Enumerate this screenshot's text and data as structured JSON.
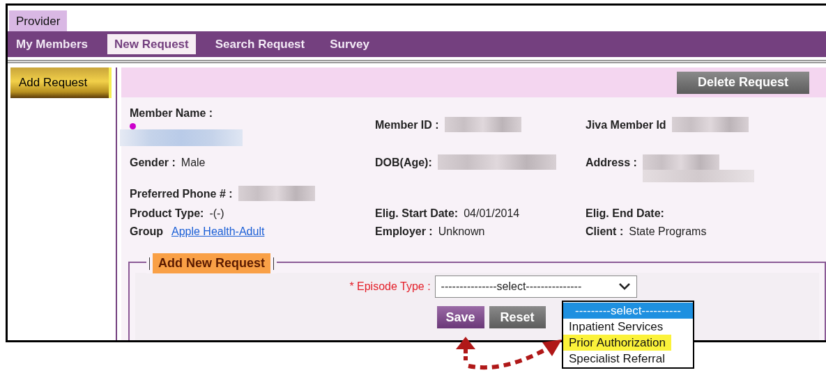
{
  "top_tab": {
    "label": "Provider"
  },
  "nav": [
    {
      "label": "My Members",
      "selected": false
    },
    {
      "label": "New Request",
      "selected": true
    },
    {
      "label": "Search Request",
      "selected": false
    },
    {
      "label": "Survey",
      "selected": false
    }
  ],
  "sidebar": {
    "button": "Add Request"
  },
  "header": {
    "delete_button": "Delete Request"
  },
  "member_fields": [
    [
      {
        "kind": "redacted",
        "label": "Member Name :",
        "flagged": true
      },
      {
        "kind": "redacted",
        "label": "Member ID :"
      },
      {
        "kind": "redacted",
        "label": "Jiva Member Id"
      }
    ],
    [
      {
        "kind": "text",
        "label": "Gender :",
        "value": "Male"
      },
      {
        "kind": "redacted",
        "label": "DOB(Age):"
      },
      {
        "kind": "redacted",
        "label": "Address :"
      }
    ],
    [
      {
        "kind": "redacted",
        "label": "Preferred Phone # :"
      }
    ],
    [
      {
        "kind": "text",
        "label": "Product Type:",
        "value": "-(-)"
      },
      {
        "kind": "text",
        "label": "Elig. Start Date:",
        "value": "04/01/2014"
      },
      {
        "kind": "text",
        "label": "Elig. End Date:"
      }
    ],
    [
      {
        "kind": "link",
        "label": "Group",
        "value": "Apple Health-Adult"
      },
      {
        "kind": "text",
        "label": "Employer :",
        "value": "Unknown"
      },
      {
        "kind": "text",
        "label": "Client :",
        "value": "State Programs"
      }
    ]
  ],
  "request_form": {
    "legend": "Add New Request",
    "episode_label": "* Episode Type :",
    "episode_value": "---------------select---------------",
    "save": "Save",
    "reset": "Reset"
  },
  "dropdown": [
    {
      "label": "---------select----------",
      "selected": true,
      "highlighted": false
    },
    {
      "label": "Inpatient Services",
      "selected": false,
      "highlighted": false
    },
    {
      "label": "Prior Authorization",
      "selected": false,
      "highlighted": true
    },
    {
      "label": "Specialist Referral",
      "selected": false,
      "highlighted": false
    }
  ]
}
